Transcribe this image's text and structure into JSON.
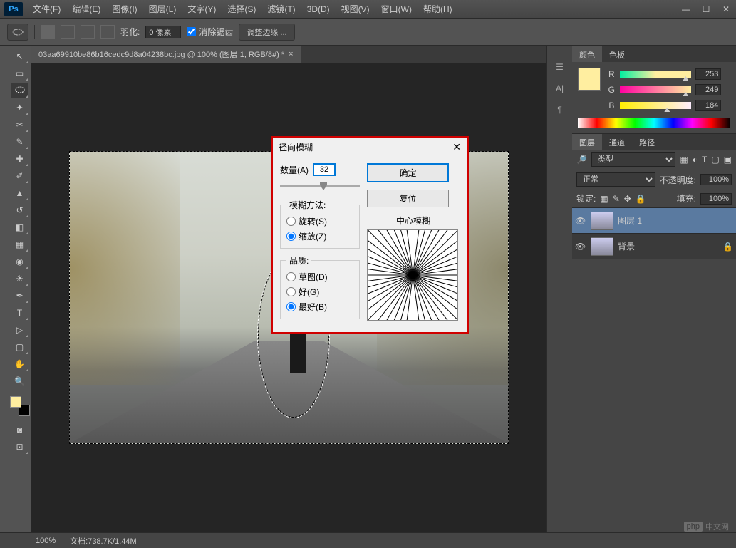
{
  "menu": {
    "items": [
      "文件(F)",
      "编辑(E)",
      "图像(I)",
      "图层(L)",
      "文字(Y)",
      "选择(S)",
      "滤镜(T)",
      "3D(D)",
      "视图(V)",
      "窗口(W)",
      "帮助(H)"
    ]
  },
  "options": {
    "feather_label": "羽化:",
    "feather_value": "0 像素",
    "antialias": "消除锯齿",
    "refine_edge": "调整边缘 ..."
  },
  "document": {
    "tab_title": "03aa69910be86b16cedc9d8a04238bc.jpg @ 100% (图层 1, RGB/8#) *"
  },
  "dialog": {
    "title": "径向模糊",
    "amount_label": "数量(A)",
    "amount_value": "32",
    "ok": "确定",
    "reset": "复位",
    "method_legend": "模糊方法:",
    "method_spin": "旋转(S)",
    "method_zoom": "缩放(Z)",
    "quality_legend": "品质:",
    "quality_draft": "草图(D)",
    "quality_good": "好(G)",
    "quality_best": "最好(B)",
    "preview_label": "中心模糊"
  },
  "color_panel": {
    "tab_color": "颜色",
    "tab_swatches": "色板",
    "r_label": "R",
    "r_value": "253",
    "g_label": "G",
    "g_value": "249",
    "b_label": "B",
    "b_value": "184"
  },
  "layers_panel": {
    "tab_layers": "图层",
    "tab_channels": "通道",
    "tab_paths": "路径",
    "filter_kind": "类型",
    "blend_mode": "正常",
    "opacity_label": "不透明度:",
    "opacity_value": "100%",
    "lock_label": "锁定:",
    "fill_label": "填充:",
    "fill_value": "100%",
    "layers": [
      {
        "name": "图层 1",
        "locked": false
      },
      {
        "name": "背景",
        "locked": true
      }
    ]
  },
  "status": {
    "zoom": "100%",
    "doc_info": "文档:738.7K/1.44M"
  },
  "watermark": {
    "logo": "php",
    "text": "中文网"
  }
}
